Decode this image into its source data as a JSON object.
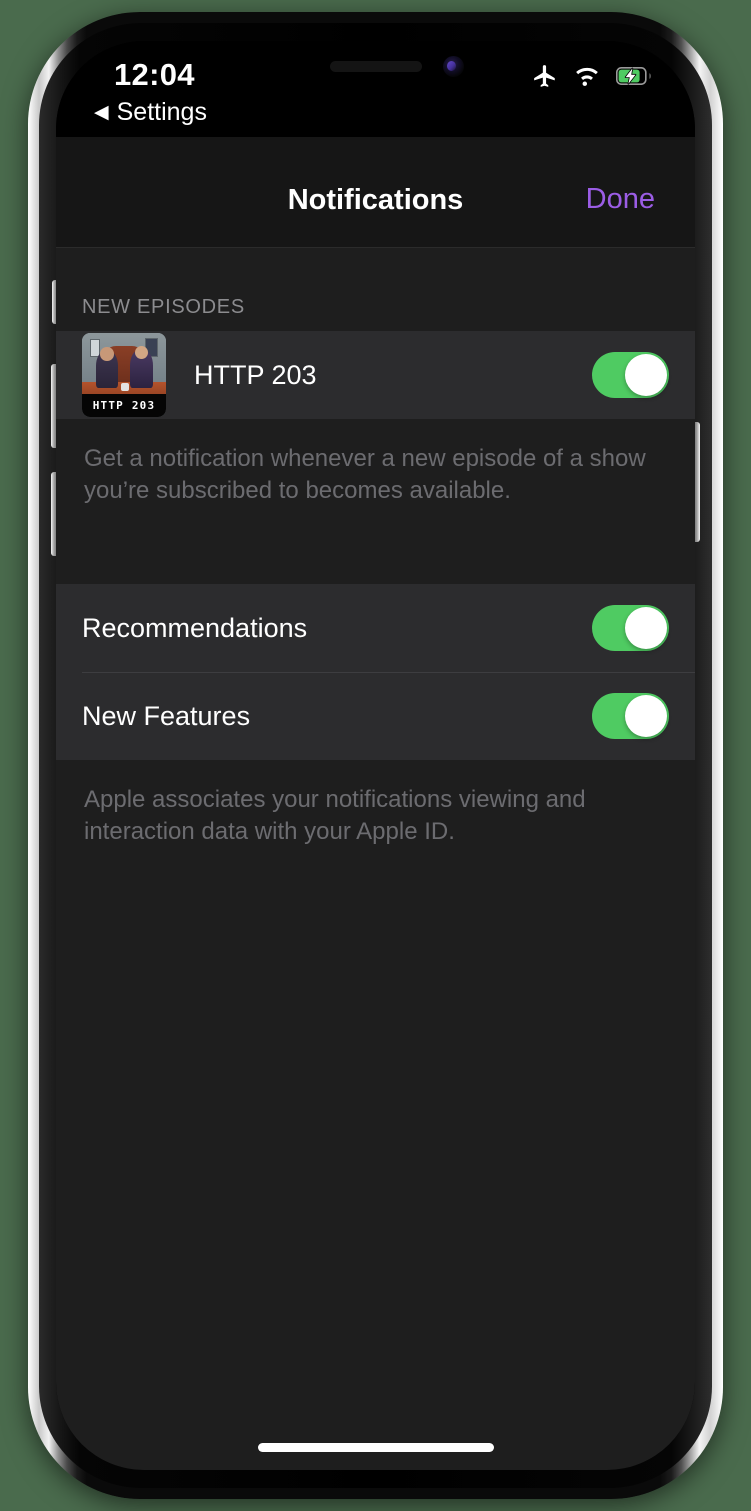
{
  "status_bar": {
    "time": "12:04",
    "back_label": "Settings",
    "back_caret": "◀",
    "icons": [
      "airplane-mode-icon",
      "wifi-icon",
      "battery-charging-icon"
    ],
    "battery_charging": true,
    "battery_color": "#4fcb62"
  },
  "nav_bar": {
    "title": "Notifications",
    "done_label": "Done",
    "done_color": "#9b5de5"
  },
  "sections": [
    {
      "header": "NEW EPISODES",
      "rows": [
        {
          "label": "HTTP 203",
          "artwork_text": "HTTP 203",
          "toggle_on": true
        }
      ],
      "footer": "Get a notification whenever a new episode of a show you’re subscribed to becomes available."
    },
    {
      "header": "",
      "rows": [
        {
          "label": "Recommendations",
          "toggle_on": true
        },
        {
          "label": "New Features",
          "toggle_on": true
        }
      ],
      "footer": "Apple associates your notifications viewing and interaction data with your Apple ID."
    }
  ],
  "colors": {
    "accent": "#9b5de5",
    "toggle_on": "#4fcb62",
    "screen_bg": "#1e1e1e",
    "row_bg": "#2c2c2e",
    "nav_bg": "#161616",
    "page_bg": "#4a6b4d"
  },
  "home_indicator": true
}
